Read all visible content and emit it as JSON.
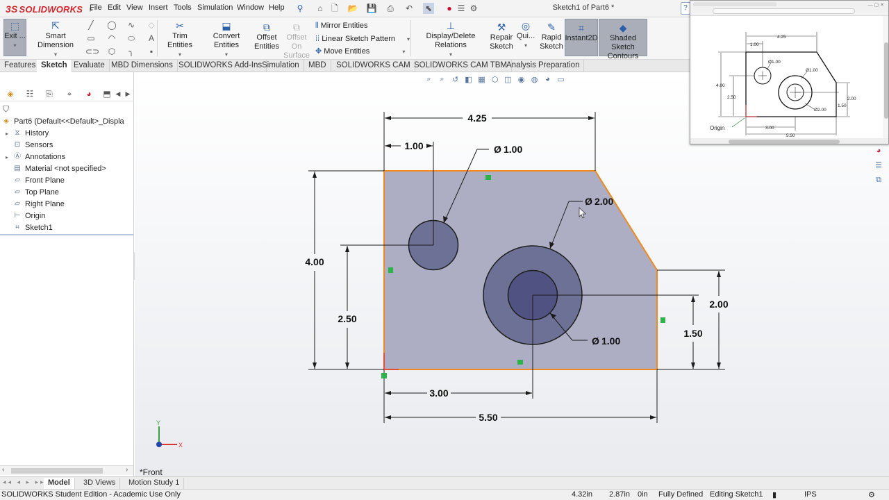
{
  "app": {
    "brand_prefix": "3S",
    "brand_name": "SOLIDWORKS",
    "document_title": "Sketch1 of Part6 *",
    "help_icon_label": "?"
  },
  "menu": [
    "File",
    "Edit",
    "View",
    "Insert",
    "Tools",
    "Simulation",
    "Window",
    "Help"
  ],
  "command_manager": {
    "exit_label": "Exit ...",
    "smart_dimension": "Smart Dimension",
    "trim_entities": "Trim Entities",
    "convert_entities": "Convert Entities",
    "offset_entities": "Offset Entities",
    "offset_on_surface": "Offset On Surface",
    "mirror_entities": "Mirror Entities",
    "linear_sketch_pattern": "Linear Sketch Pattern",
    "move_entities": "Move Entities",
    "display_delete_relations": "Display/Delete Relations",
    "repair_sketch": "Repair Sketch",
    "quick_snaps": "Qui...",
    "rapid_sketch": "Rapid Sketch",
    "instant2d": "Instant2D",
    "shaded_sketch_contours": "Shaded Sketch Contours"
  },
  "tabs": [
    "Features",
    "Sketch",
    "Evaluate",
    "MBD Dimensions",
    "SOLIDWORKS Add-Ins",
    "Simulation",
    "MBD",
    "SOLIDWORKS CAM",
    "SOLIDWORKS CAM TBM",
    "Analysis Preparation"
  ],
  "active_tab": "Sketch",
  "feature_tree": {
    "root": "Part6  (Default<<Default>_Displa",
    "items": [
      {
        "label": "History",
        "icon": "history-icon",
        "expandable": true
      },
      {
        "label": "Sensors",
        "icon": "sensors-icon",
        "expandable": false
      },
      {
        "label": "Annotations",
        "icon": "annotations-icon",
        "expandable": true
      },
      {
        "label": "Material <not specified>",
        "icon": "material-icon",
        "expandable": false
      },
      {
        "label": "Front Plane",
        "icon": "plane-icon",
        "expandable": false
      },
      {
        "label": "Top Plane",
        "icon": "plane-icon",
        "expandable": false
      },
      {
        "label": "Right Plane",
        "icon": "plane-icon",
        "expandable": false
      },
      {
        "label": "Origin",
        "icon": "origin-icon",
        "expandable": false
      },
      {
        "label": "Sketch1",
        "icon": "sketch-icon",
        "expandable": false
      }
    ]
  },
  "sketch": {
    "dimensions": {
      "top_width": "4.25",
      "hole_offset_x": "1.00",
      "small_hole_dia": "1.00",
      "large_circle_dia": "2.00",
      "inner_hole_dia": "1.00",
      "height": "4.00",
      "hole_height": "2.50",
      "right_height": "2.00",
      "center_height": "1.50",
      "center_x": "3.00",
      "total_width": "5.50"
    },
    "diameter_symbol": "Ø",
    "view_name": "*Front",
    "axis_x": "X",
    "axis_y": "Y"
  },
  "reference_drawing": {
    "top_width": "4.25",
    "hole_offset": "1.00",
    "small_hole": "Ø1.00",
    "inner_hole": "Ø1.00",
    "large_circle": "Ø2.00",
    "height": "4.00",
    "hole_height": "2.50",
    "right_height": "2.00",
    "center_height": "1.50",
    "center_x": "3.00",
    "total_width": "5.50",
    "origin_label": "Origin"
  },
  "bottom_tabs": [
    "Model",
    "3D Views",
    "Motion Study 1"
  ],
  "active_bottom_tab": "Model",
  "status": {
    "edition": "SOLIDWORKS Student Edition - Academic Use Only",
    "x": "4.32in",
    "y": "2.87in",
    "z": "0in",
    "state": "Fully Defined",
    "mode": "Editing Sketch1",
    "units": "IPS"
  },
  "colors": {
    "sketch_fill": "#adaec4",
    "sketch_edge": "#f08a1c",
    "circle_fill": "#6e7196",
    "inner_fill": "#505381",
    "relation_green": "#2db34a",
    "brand_red": "#d0262d"
  }
}
